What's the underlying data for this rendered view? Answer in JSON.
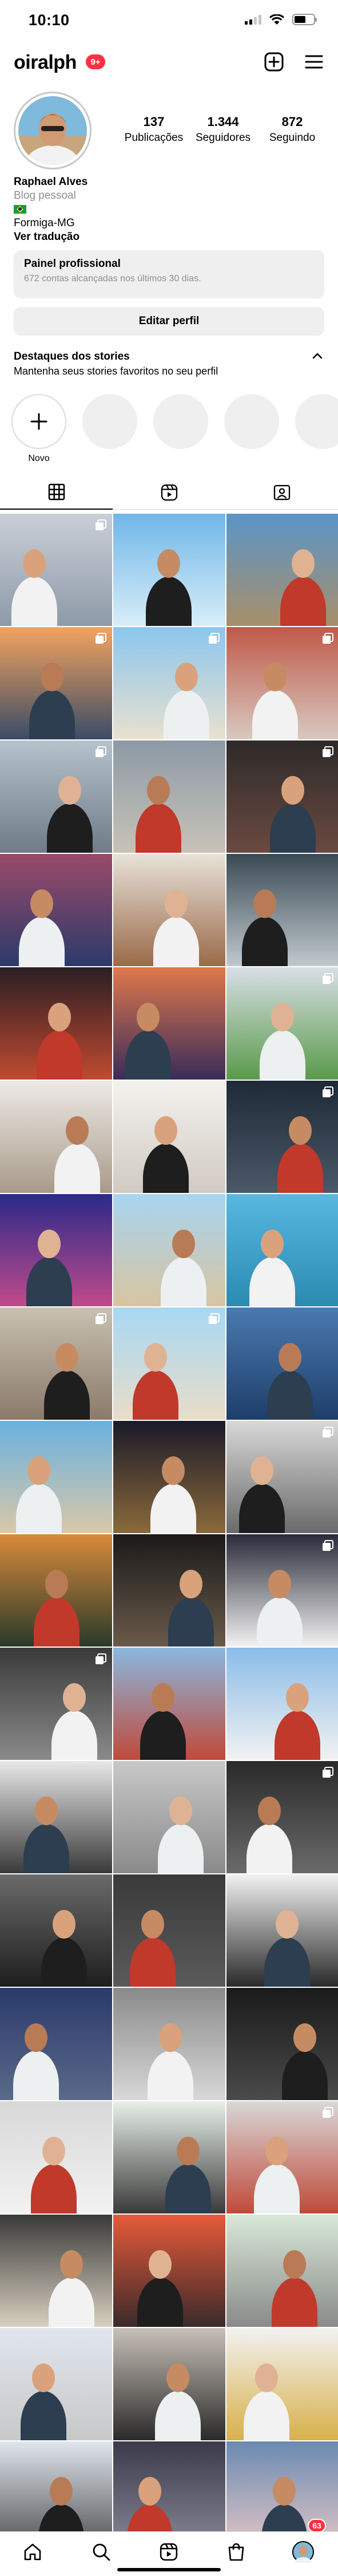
{
  "status_bar": {
    "time": "10:10"
  },
  "header": {
    "username": "oiralph",
    "notification_badge": "9+"
  },
  "profile": {
    "stats": [
      {
        "value": "137",
        "label": "Publicações"
      },
      {
        "value": "1.344",
        "label": "Seguidores"
      },
      {
        "value": "872",
        "label": "Seguindo"
      }
    ],
    "name": "Raphael Alves",
    "category": "Blog pessoal",
    "location": "Formiga-MG",
    "translate_link": "Ver tradução"
  },
  "dashboard": {
    "title": "Painel profissional",
    "subtitle": "672 contas alcançadas nos últimos 30 dias."
  },
  "edit_profile_label": "Editar perfil",
  "highlights": {
    "title": "Destaques dos stories",
    "subtitle": "Mantenha seus stories favoritos no seu perfil",
    "new_label": "Novo"
  },
  "bottom_nav": {
    "profile_badge": "63"
  },
  "colors": {
    "notification_red": "#ff3040",
    "divider": "#dbdbdb",
    "secondary_text": "#8e8e8e",
    "button_bg": "#efefef"
  },
  "icons": [
    "create-post-icon",
    "menu-icon",
    "grid-icon",
    "reels-icon",
    "tagged-icon",
    "home-icon",
    "search-icon",
    "reels-nav-icon",
    "shop-icon",
    "chevron-up-icon"
  ]
}
